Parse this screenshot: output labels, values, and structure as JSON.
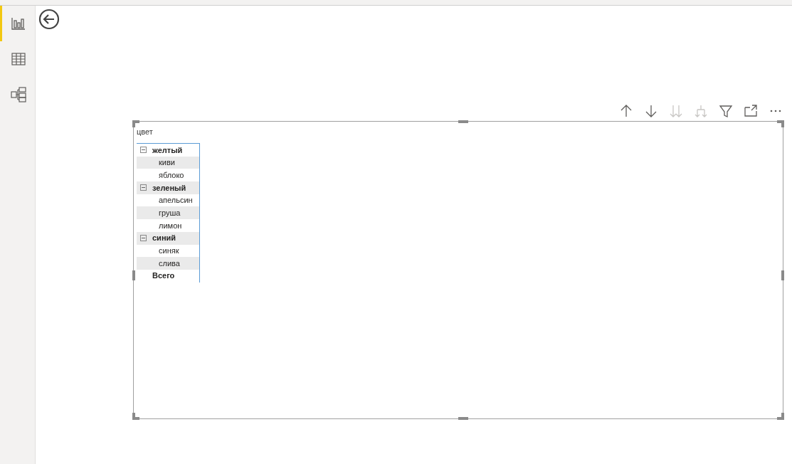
{
  "sidebar": {
    "items": [
      {
        "kind": "report",
        "selected": true
      },
      {
        "kind": "data",
        "selected": false
      },
      {
        "kind": "model",
        "selected": false
      }
    ]
  },
  "toolbar": [
    {
      "kind": "sort-up",
      "disabled": false
    },
    {
      "kind": "sort-down",
      "disabled": false
    },
    {
      "kind": "expand-all",
      "disabled": true
    },
    {
      "kind": "expand-next",
      "disabled": true
    },
    {
      "kind": "filter",
      "disabled": false
    },
    {
      "kind": "focus",
      "disabled": false
    },
    {
      "kind": "more",
      "disabled": false
    }
  ],
  "visual": {
    "header": "цвет",
    "matrix": {
      "rows": [
        {
          "label": "желтый",
          "expanded": true,
          "children": [
            {
              "label": "киви"
            },
            {
              "label": "яблоко"
            }
          ]
        },
        {
          "label": "зеленый",
          "expanded": true,
          "children": [
            {
              "label": "апельсин"
            },
            {
              "label": "груша"
            },
            {
              "label": "лимон"
            }
          ]
        },
        {
          "label": "синий",
          "expanded": true,
          "children": [
            {
              "label": "синяк"
            },
            {
              "label": "слива"
            }
          ]
        }
      ],
      "total": "Всего"
    }
  }
}
